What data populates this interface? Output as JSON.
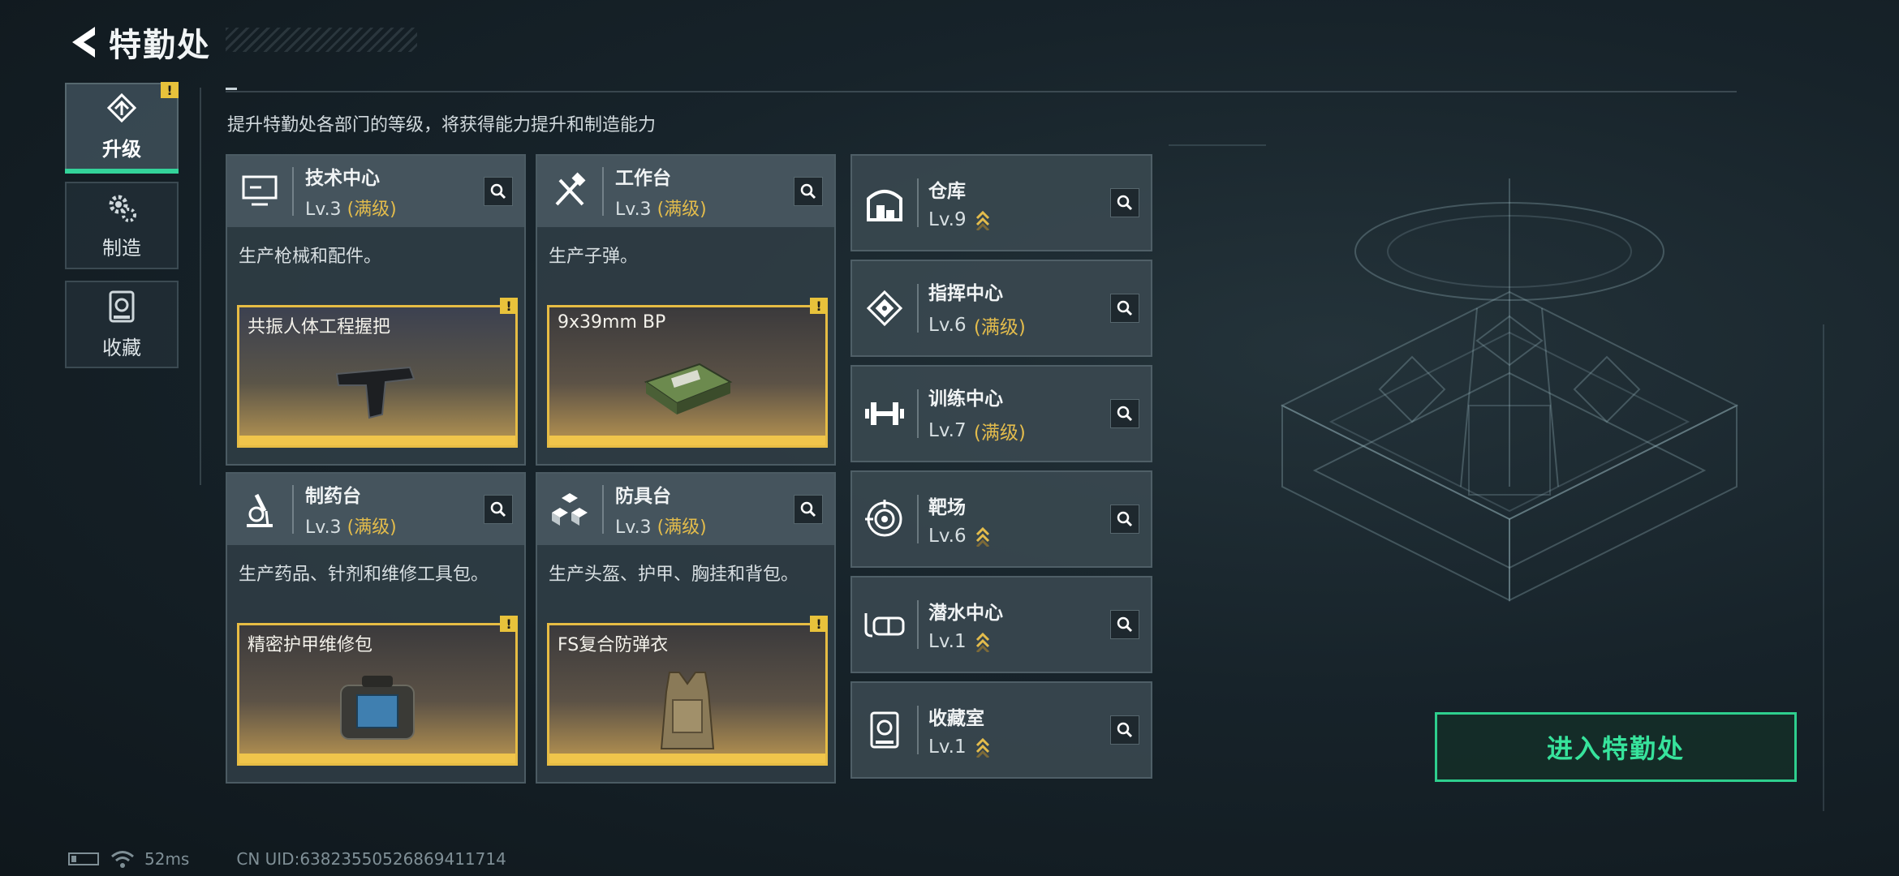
{
  "header": {
    "title": "特勤处"
  },
  "sidebar": {
    "tabs": [
      {
        "label": "升级",
        "active": true,
        "alert": "!"
      },
      {
        "label": "制造",
        "active": false
      },
      {
        "label": "收藏",
        "active": false
      }
    ]
  },
  "subtitle": "提升特勤处各部门的等级，将获得能力提升和制造能力",
  "departments": [
    {
      "name": "技术中心",
      "level": "Lv.3",
      "max_tag": "(满级)",
      "desc": "生产枪械和配件。",
      "craft": "共振人体工程握把",
      "icon": "computer-icon"
    },
    {
      "name": "工作台",
      "level": "Lv.3",
      "max_tag": "(满级)",
      "desc": "生产子弹。",
      "craft": "9x39mm BP",
      "icon": "tools-icon"
    },
    {
      "name": "制药台",
      "level": "Lv.3",
      "max_tag": "(满级)",
      "desc": "生产药品、针剂和维修工具包。",
      "craft": "精密护甲维修包",
      "icon": "microscope-icon"
    },
    {
      "name": "防具台",
      "level": "Lv.3",
      "max_tag": "(满级)",
      "desc": "生产头盔、护甲、胸挂和背包。",
      "craft": "FS复合防弹衣",
      "icon": "armor-blocks-icon"
    }
  ],
  "buildings": [
    {
      "name": "仓库",
      "level": "Lv.9",
      "max_tag": "",
      "upgradable": true,
      "icon": "warehouse-icon"
    },
    {
      "name": "指挥中心",
      "level": "Lv.6",
      "max_tag": "(满级)",
      "upgradable": false,
      "icon": "chip-icon"
    },
    {
      "name": "训练中心",
      "level": "Lv.7",
      "max_tag": "(满级)",
      "upgradable": false,
      "icon": "dumbbell-icon"
    },
    {
      "name": "靶场",
      "level": "Lv.6",
      "max_tag": "",
      "upgradable": true,
      "icon": "target-icon"
    },
    {
      "name": "潜水中心",
      "level": "Lv.1",
      "max_tag": "",
      "upgradable": true,
      "icon": "diving-mask-icon"
    },
    {
      "name": "收藏室",
      "level": "Lv.1",
      "max_tag": "",
      "upgradable": true,
      "icon": "collection-icon"
    }
  ],
  "alert_mark": "!",
  "enter_button": "进入特勤处",
  "status": {
    "ping": "52ms",
    "uid": "CN UID:6382355052686941171​4"
  },
  "colors": {
    "accent_green": "#33d39a",
    "gold": "#e3bc4c"
  }
}
